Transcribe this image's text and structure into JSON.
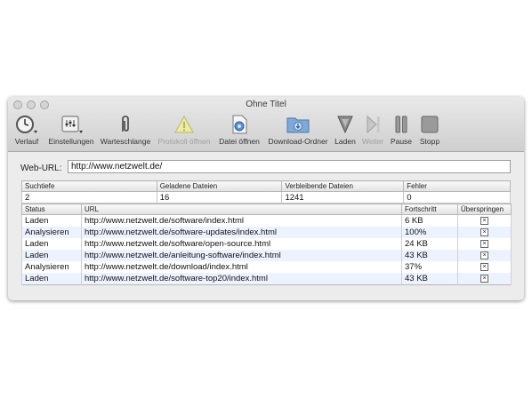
{
  "window": {
    "title": "Ohne Titel"
  },
  "toolbar": {
    "items": [
      {
        "label": "Verlauf",
        "icon": "clock-icon",
        "enabled": true
      },
      {
        "label": "Einstellungen",
        "icon": "settings-icon",
        "enabled": true
      },
      {
        "label": "Warteschlange",
        "icon": "paperclip-icon",
        "enabled": true
      },
      {
        "label": "Protokoll öffnen",
        "icon": "warning-icon",
        "enabled": false
      },
      {
        "label": "Datei öffnen",
        "icon": "file-icon",
        "enabled": true
      },
      {
        "label": "Download-Ordner",
        "icon": "folder-icon",
        "enabled": true
      },
      {
        "label": "Laden",
        "icon": "download-arrow-icon",
        "enabled": true
      },
      {
        "label": "Weiter",
        "icon": "play-icon",
        "enabled": false
      },
      {
        "label": "Pause",
        "icon": "pause-icon",
        "enabled": true
      },
      {
        "label": "Stopp",
        "icon": "stop-icon",
        "enabled": true
      }
    ]
  },
  "url": {
    "label": "Web-URL:",
    "value": "http://www.netzwelt.de/"
  },
  "stats": {
    "headers": [
      "Suchtiefe",
      "Geladene Dateien",
      "Verbleibende Dateien",
      "Fehler"
    ],
    "values": [
      "2",
      "16",
      "1241",
      "0"
    ]
  },
  "jobs": {
    "headers": [
      "Status",
      "URL",
      "Fortschritt",
      "Überspringen"
    ],
    "rows": [
      {
        "status": "Laden",
        "url": "http://www.netzwelt.de/software/index.html",
        "progress": "6 KB"
      },
      {
        "status": "Analysieren",
        "url": "http://www.netzwelt.de/software-updates/index.html",
        "progress": "100%"
      },
      {
        "status": "Laden",
        "url": "http://www.netzwelt.de/software/open-source.html",
        "progress": "24 KB"
      },
      {
        "status": "Laden",
        "url": "http://www.netzwelt.de/anleitung-software/index.html",
        "progress": "43 KB"
      },
      {
        "status": "Analysieren",
        "url": "http://www.netzwelt.de/download/index.html",
        "progress": "37%"
      },
      {
        "status": "Laden",
        "url": "http://www.netzwelt.de/software-top20/index.html",
        "progress": "43 KB"
      }
    ],
    "skip_glyph": "×"
  }
}
